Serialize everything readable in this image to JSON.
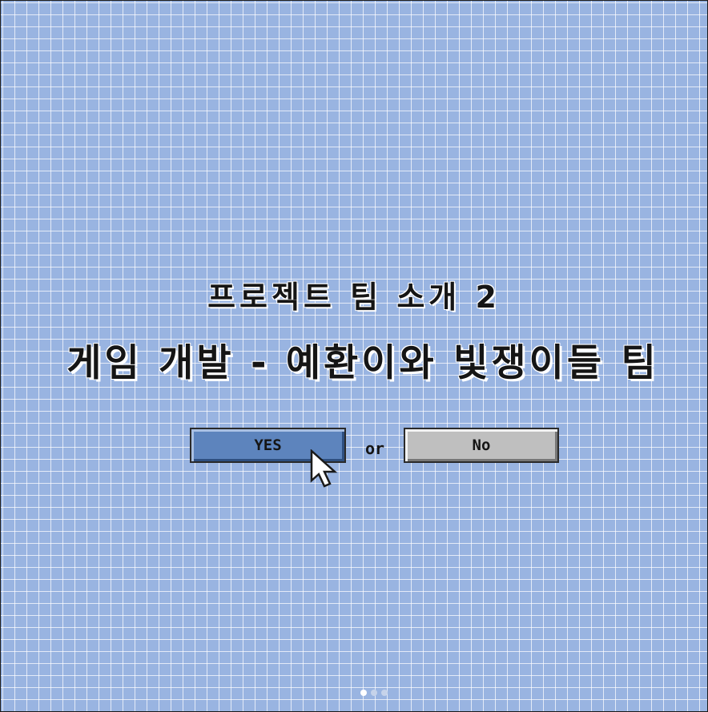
{
  "slide": {
    "title_line1": "프로젝트 팀 소개 2",
    "title_line2": "게임 개발 - 예환이와 빛쟁이들 팀"
  },
  "dialog": {
    "yes_label": "YES",
    "or_label": "or",
    "no_label": "No"
  },
  "icons": {
    "cursor": "mouse-pointer-icon"
  },
  "carousel": {
    "page_count": 3,
    "active_index": 0
  },
  "colors": {
    "background": "#99b4e1",
    "grid_line": "#ffffff",
    "yes_button": "#5d84bd",
    "no_button": "#bfbfbf",
    "text": "#151515",
    "dot_active": "#ffffff",
    "dot_inactive": "#c6d3ea"
  }
}
